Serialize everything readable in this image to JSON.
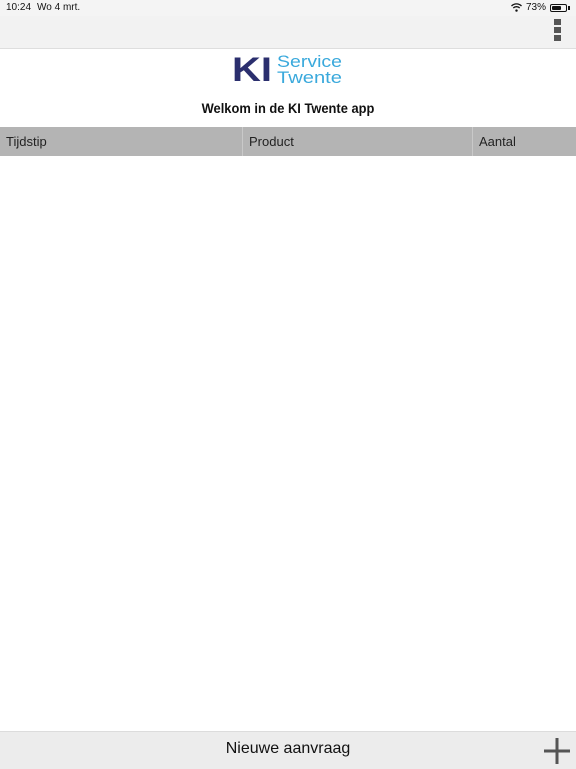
{
  "status": {
    "time": "10:24",
    "date": "Wo 4 mrt.",
    "battery_percent": "73%",
    "battery_level": 0.73
  },
  "nav": {
    "menu_icon": "kebab-menu-icon"
  },
  "brand": {
    "logo_ki": "KI",
    "logo_line1": "Service",
    "logo_line2": "Twente",
    "colors": {
      "dark_blue": "#2b2f6e",
      "light_blue": "#3aa9dc"
    }
  },
  "welcome_text": "Welkom in de KI Twente app",
  "table": {
    "columns": [
      "Tijdstip",
      "Product",
      "Aantal"
    ],
    "rows": []
  },
  "footer": {
    "new_request_label": "Nieuwe aanvraag",
    "add_icon": "plus-icon"
  }
}
